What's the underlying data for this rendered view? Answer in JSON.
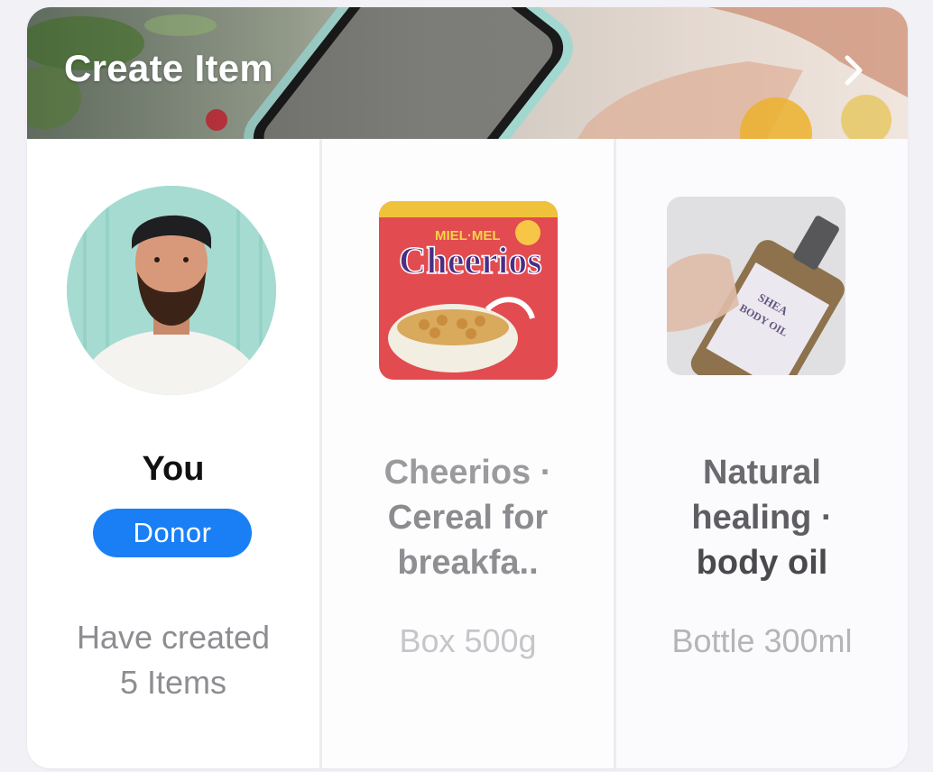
{
  "header": {
    "title": "Create Item",
    "chevron_icon": "chevron-right-icon"
  },
  "profile": {
    "name": "You",
    "badge": "Donor",
    "badge_color": "#1a7ff5",
    "stats_line1": "Have created",
    "stats_line2": "5 Items"
  },
  "items": [
    {
      "title_line1": "Cheerios ·",
      "title_line2": "Cereal for",
      "title_line3": "breakfa..",
      "quantity": "Box 500g",
      "package_brand": "MIEL·MEL",
      "package_name": "Cheerios"
    },
    {
      "title_line1": "Natural",
      "title_line2": "healing ·",
      "title_line3": "body oil",
      "quantity": "Bottle 300ml",
      "package_label1": "SHEA",
      "package_label2": "BODY OIL"
    }
  ]
}
